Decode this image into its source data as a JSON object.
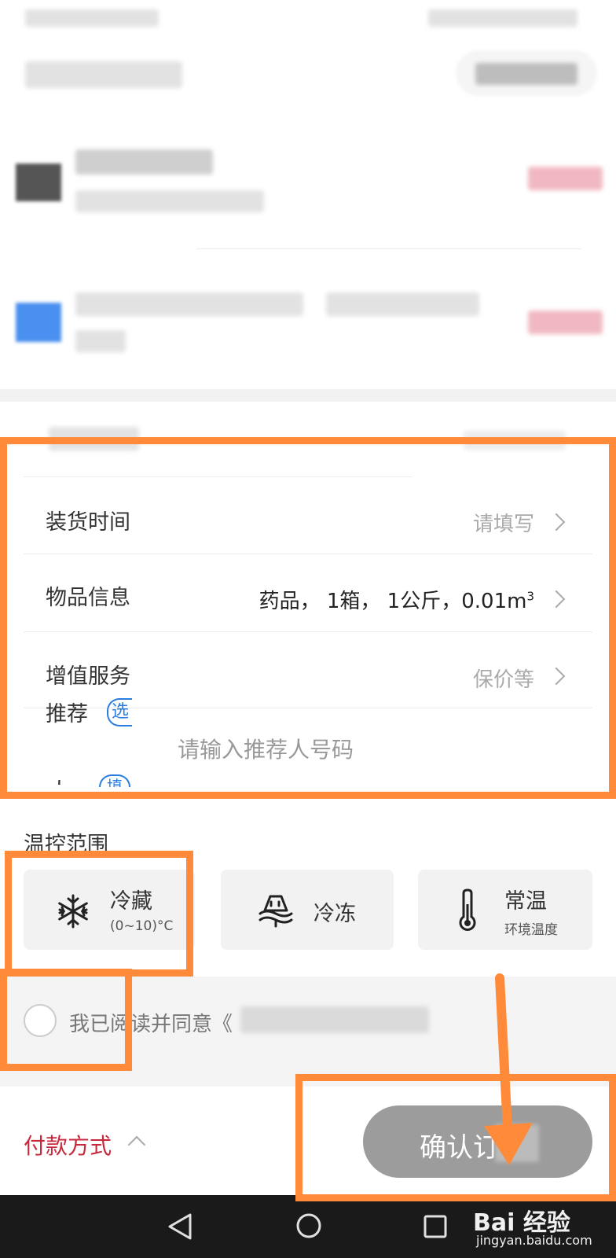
{
  "form": {
    "load_time": {
      "label": "装货时间",
      "value": "请填写"
    },
    "item_info": {
      "label": "物品信息",
      "value": "药品， 1箱， 1公斤，0.01m",
      "unit_sup": "3"
    },
    "value_added": {
      "label_line1": "增值服务",
      "value": "保价等"
    },
    "referrer": {
      "label_line1": "推荐",
      "badge1": "选",
      "placeholder": "请输入推荐人号码",
      "label_line2": "人",
      "badge2": "填"
    }
  },
  "temperature": {
    "title": "温控范围",
    "options": [
      {
        "name": "冷藏",
        "sub": "(0~10)°C",
        "icon": "snowflake-icon"
      },
      {
        "name": "冷冻",
        "sub": "",
        "icon": "frozen-icon"
      },
      {
        "name": "常温",
        "sub": "环境温度",
        "icon": "thermometer-icon"
      }
    ]
  },
  "agreement": {
    "text": "我已阅读并同意《"
  },
  "footer": {
    "payment": "付款方式",
    "confirm": "确认订"
  },
  "watermark": {
    "brand": "Bai 经验",
    "url": "jingyan.baidu.com"
  },
  "colors": {
    "accent_red": "#c8283c",
    "highlight_orange": "#ff8a3a",
    "button_gray": "#9c9c9c",
    "nav_bg": "#1a1a1a"
  }
}
